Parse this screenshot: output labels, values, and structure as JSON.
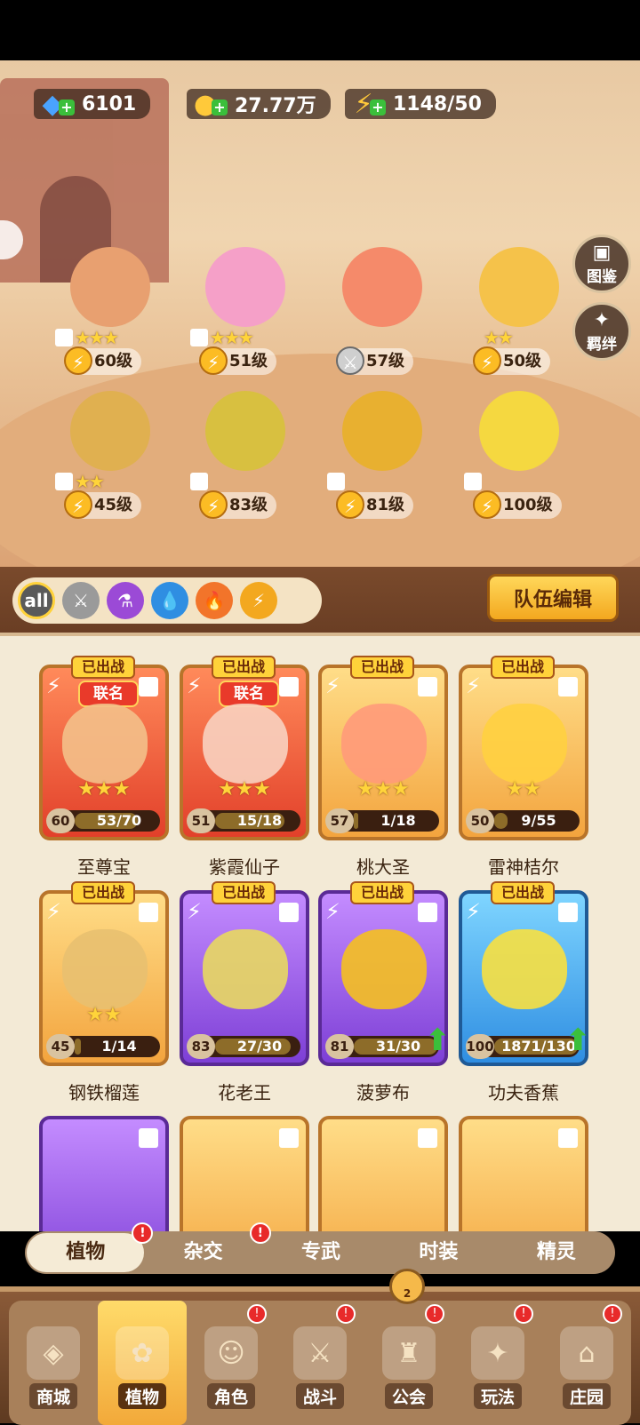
{
  "resources": {
    "gems": "6101",
    "coins": "27.77万",
    "energy": "1148/50"
  },
  "side_buttons": {
    "codex": "图鉴",
    "bond": "羁绊"
  },
  "lineup": [
    {
      "level": "60级",
      "stars": "★★★"
    },
    {
      "level": "51级",
      "stars": "★★★"
    },
    {
      "level": "57级",
      "stars": ""
    },
    {
      "level": "50级",
      "stars": "★★"
    },
    {
      "level": "45级",
      "stars": "★★"
    },
    {
      "level": "83级",
      "stars": ""
    },
    {
      "level": "81级",
      "stars": ""
    },
    {
      "level": "100级",
      "stars": ""
    }
  ],
  "filters": {
    "all_label": "all",
    "team_edit": "队伍编辑"
  },
  "cards": [
    {
      "name": "至尊宝",
      "status": "已出战",
      "tag": "联名",
      "level": "60",
      "progress": "53/70",
      "fill": 0.757,
      "stars": "★★★",
      "color": "red"
    },
    {
      "name": "紫霞仙子",
      "status": "已出战",
      "tag": "联名",
      "level": "51",
      "progress": "15/18",
      "fill": 0.833,
      "stars": "★★★",
      "color": "red"
    },
    {
      "name": "桃大圣",
      "status": "已出战",
      "tag": "",
      "level": "57",
      "progress": "1/18",
      "fill": 0.056,
      "stars": "★★★",
      "color": "orange"
    },
    {
      "name": "雷神桔尔",
      "status": "已出战",
      "tag": "",
      "level": "50",
      "progress": "9/55",
      "fill": 0.164,
      "stars": "★★",
      "color": "orange"
    },
    {
      "name": "钢铁榴莲",
      "status": "已出战",
      "tag": "",
      "level": "45",
      "progress": "1/14",
      "fill": 0.071,
      "stars": "★★",
      "color": "orange"
    },
    {
      "name": "花老王",
      "status": "已出战",
      "tag": "",
      "level": "83",
      "progress": "27/30",
      "fill": 0.9,
      "stars": "",
      "color": "purple"
    },
    {
      "name": "菠萝布",
      "status": "已出战",
      "tag": "",
      "level": "81",
      "progress": "31/30",
      "fill": 1,
      "stars": "",
      "color": "purple"
    },
    {
      "name": "功夫香蕉",
      "status": "已出战",
      "tag": "",
      "level": "100",
      "progress": "1871/130",
      "fill": 1,
      "stars": "",
      "color": "blue"
    }
  ],
  "subtabs": [
    "植物",
    "杂交",
    "专武",
    "时装",
    "精灵"
  ],
  "nav": [
    "商城",
    "植物",
    "角色",
    "战斗",
    "公会",
    "玩法",
    "庄园"
  ],
  "guild_count": "2",
  "colors": {
    "accent_gold": "#f3a81f",
    "panel_bg": "#f3ead6",
    "notify_red": "#e82a2a"
  }
}
